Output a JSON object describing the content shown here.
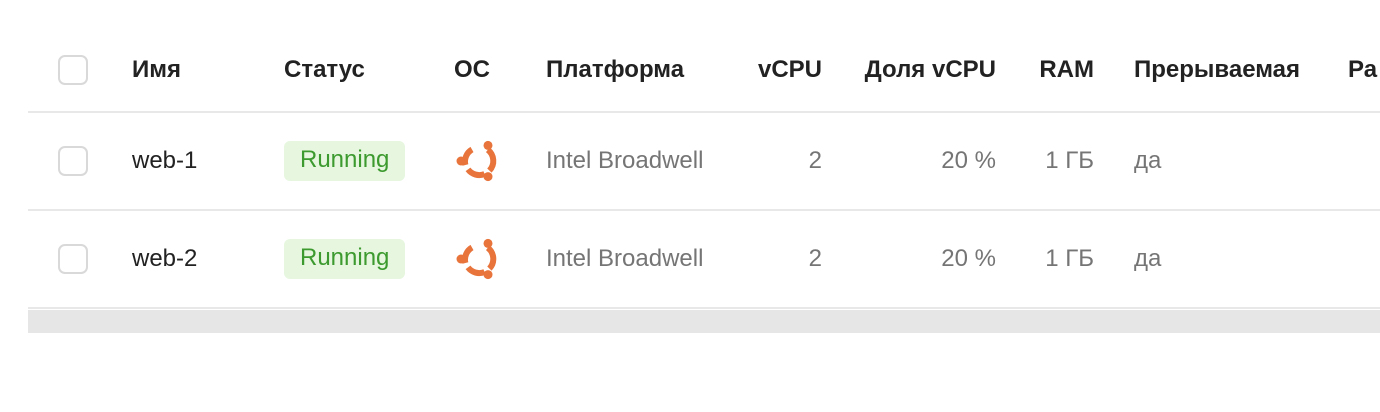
{
  "columns": {
    "name": "Имя",
    "status": "Статус",
    "os": "ОС",
    "platform": "Платформа",
    "vcpu": "vCPU",
    "vcpu_share": "Доля vCPU",
    "ram": "RAM",
    "preemptible": "Прерываемая",
    "extra": "Ра"
  },
  "rows": [
    {
      "name": "web-1",
      "status": "Running",
      "os_icon": "ubuntu-icon",
      "platform": "Intel Broadwell",
      "vcpu": "2",
      "vcpu_share": "20 %",
      "ram": "1 ГБ",
      "preemptible": "да"
    },
    {
      "name": "web-2",
      "status": "Running",
      "os_icon": "ubuntu-icon",
      "platform": "Intel Broadwell",
      "vcpu": "2",
      "vcpu_share": "20 %",
      "ram": "1 ГБ",
      "preemptible": "да"
    }
  ],
  "colors": {
    "status_running_bg": "#e6f6df",
    "status_running_text": "#3c9a2e",
    "ubuntu_orange": "#e8743b"
  }
}
